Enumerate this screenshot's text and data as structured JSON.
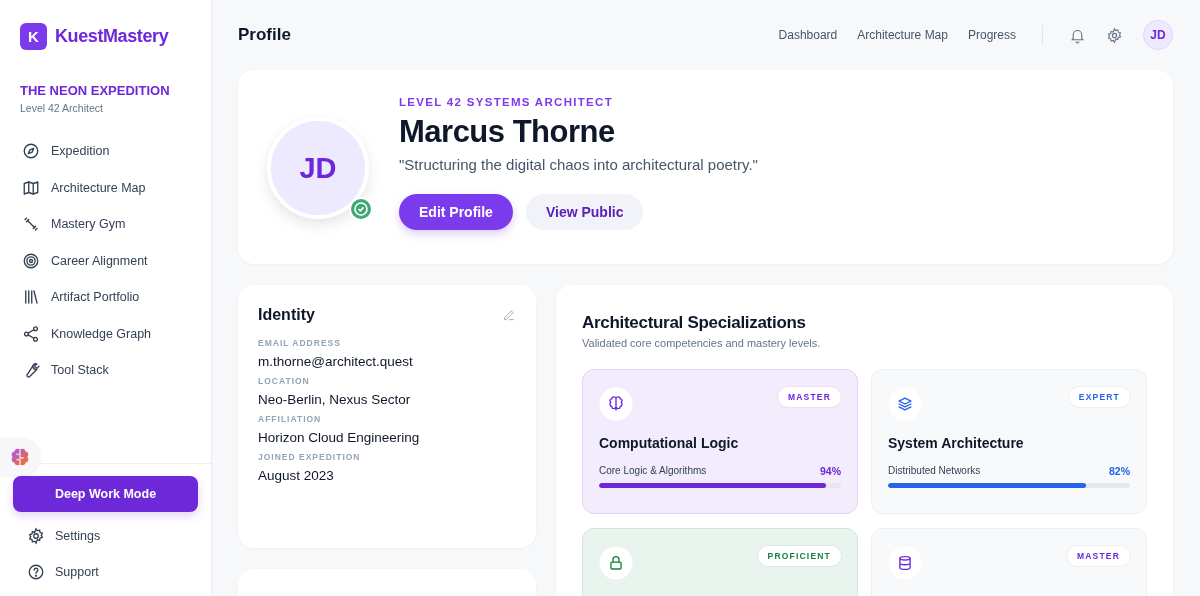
{
  "brand": {
    "logo_letter": "K",
    "name": "KuestMastery"
  },
  "expedition": {
    "title": "THE NEON EXPEDITION",
    "subtitle": "Level 42 Architect"
  },
  "sidebar": {
    "items": [
      {
        "label": "Expedition",
        "selected": false
      },
      {
        "label": "Architecture Map",
        "selected": false
      },
      {
        "label": "Mastery Gym",
        "selected": false
      },
      {
        "label": "Career Alignment",
        "selected": false
      },
      {
        "label": "Artifact Portfolio",
        "selected": false
      },
      {
        "label": "Knowledge Graph",
        "selected": false
      },
      {
        "label": "Tool Stack",
        "selected": false
      }
    ],
    "cta": "Deep Work Mode",
    "footer_items": [
      {
        "label": "Settings"
      },
      {
        "label": "Support"
      }
    ]
  },
  "header": {
    "title": "Profile",
    "nav": [
      {
        "label": "Dashboard",
        "selected": false
      },
      {
        "label": "Architecture Map",
        "selected": false
      },
      {
        "label": "Progress",
        "selected": false
      }
    ],
    "avatar": "JD"
  },
  "hero": {
    "avatar": "JD",
    "verified": true,
    "rank": "LEVEL 42 SYSTEMS ARCHITECT",
    "name": "Marcus Thorne",
    "quote": "\"Structuring the digital chaos into architectural poetry.\"",
    "buttons": [
      {
        "label": "Edit Profile",
        "kind": "primary"
      },
      {
        "label": "View Public",
        "kind": "secondary"
      }
    ]
  },
  "identity": {
    "title": "Identity",
    "fields": [
      {
        "label": "EMAIL ADDRESS",
        "value": "m.thorne@architect.quest"
      },
      {
        "label": "LOCATION",
        "value": "Neo-Berlin, Nexus Sector"
      },
      {
        "label": "AFFILIATION",
        "value": "Horizon Cloud Engineering"
      },
      {
        "label": "JOINED EXPEDITION",
        "value": "August 2023"
      }
    ]
  },
  "specializations": {
    "title": "Architectural Specializations",
    "subtitle": "Validated core competencies and mastery levels.",
    "cards": [
      {
        "badge": "MASTER",
        "color": "#6d28d9",
        "tinted": true,
        "title": "Computational Logic",
        "skill": "Core Logic & Algorithms",
        "reading": "94%",
        "level": 0.94
      },
      {
        "badge": "EXPERT",
        "color": "#2563eb",
        "tinted": false,
        "title": "System Architecture",
        "skill": "Distributed Networks",
        "reading": "82%",
        "level": 0.82
      },
      {
        "badge": "PROFICIENT",
        "color": "#15803d",
        "tinted": true
      },
      {
        "badge": "MASTER",
        "color": "#6d28d9",
        "tinted": false
      }
    ]
  }
}
